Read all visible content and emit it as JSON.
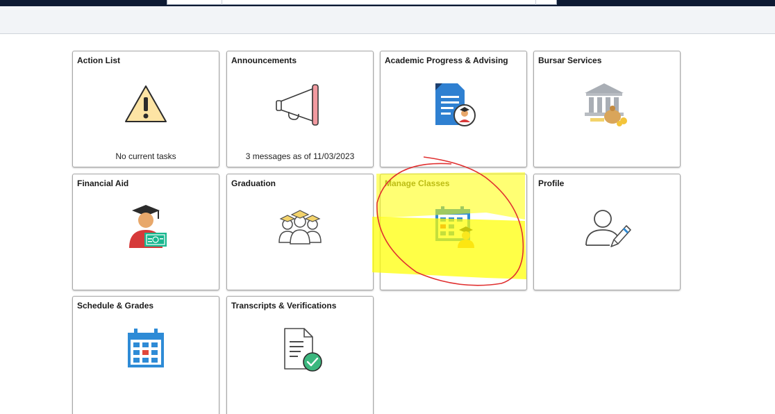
{
  "tiles": {
    "action_list": {
      "title": "Action List",
      "footer": "No current tasks",
      "icon": "warning-triangle-icon"
    },
    "announcements": {
      "title": "Announcements",
      "footer": "3 messages as of 11/03/2023",
      "icon": "megaphone-icon"
    },
    "academic_progress": {
      "title": "Academic Progress & Advising",
      "icon": "advising-document-icon"
    },
    "bursar": {
      "title": "Bursar Services",
      "icon": "bank-money-icon"
    },
    "financial_aid": {
      "title": "Financial Aid",
      "icon": "graduate-money-icon"
    },
    "graduation": {
      "title": "Graduation",
      "icon": "graduates-group-icon"
    },
    "manage_classes": {
      "title": "Manage Classes",
      "icon": "calendar-student-icon"
    },
    "profile": {
      "title": "Profile",
      "icon": "person-edit-icon"
    },
    "schedule_grades": {
      "title": "Schedule & Grades",
      "icon": "calendar-grid-icon"
    },
    "transcripts": {
      "title": "Transcripts & Verifications",
      "icon": "document-check-icon"
    }
  },
  "colors": {
    "highlight": "#ffff00",
    "annotation_circle": "#e03030",
    "nav_bar": "#0d1a33",
    "tile_border": "#a6a6a6"
  }
}
